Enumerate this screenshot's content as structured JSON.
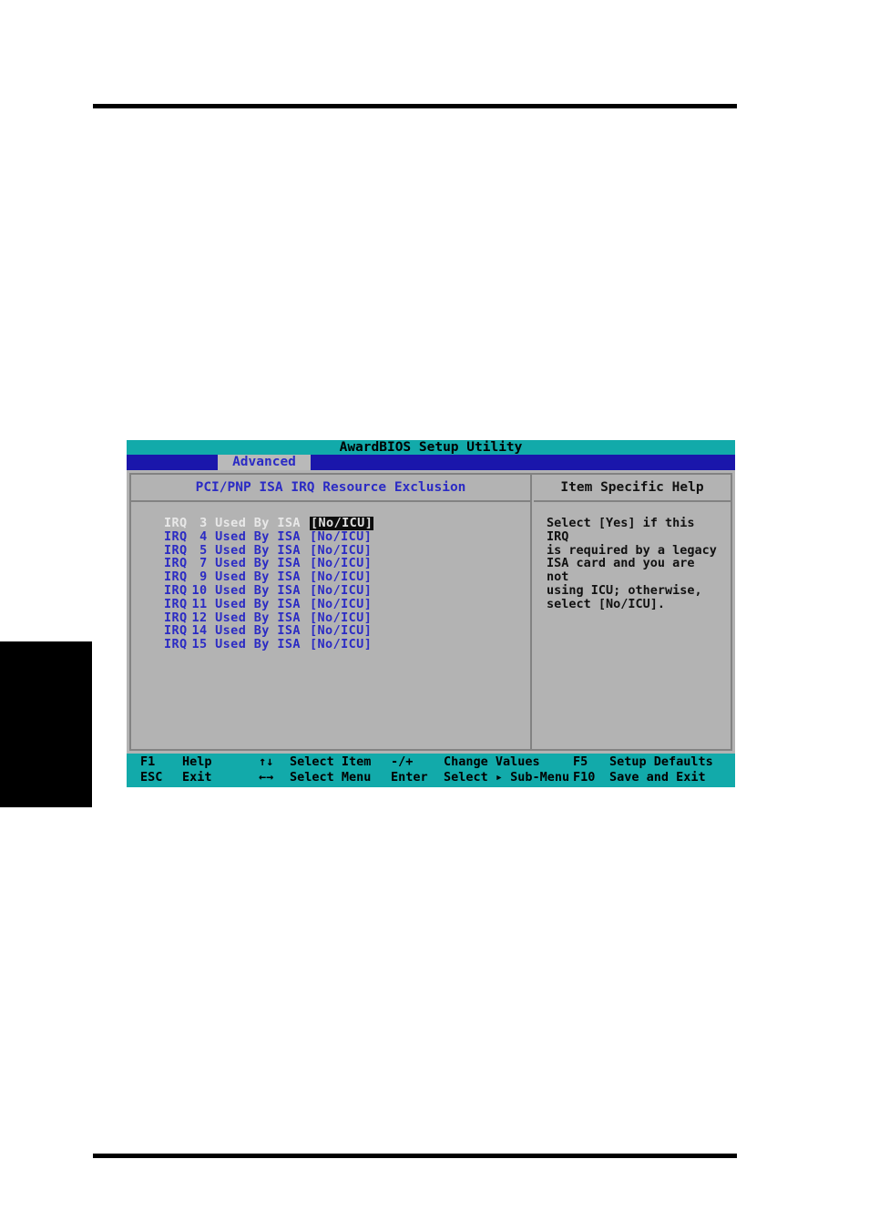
{
  "window": {
    "title": "AwardBIOS Setup Utility",
    "active_tab": "Advanced"
  },
  "main_panel": {
    "header": "PCI/PNP ISA IRQ Resource Exclusion",
    "rows": [
      {
        "label": "IRQ",
        "num": "3",
        "suffix": "Used By ISA",
        "value": "[No/ICU]",
        "selected": true
      },
      {
        "label": "IRQ",
        "num": "4",
        "suffix": "Used By ISA",
        "value": "[No/ICU]",
        "selected": false
      },
      {
        "label": "IRQ",
        "num": "5",
        "suffix": "Used By ISA",
        "value": "[No/ICU]",
        "selected": false
      },
      {
        "label": "IRQ",
        "num": "7",
        "suffix": "Used By ISA",
        "value": "[No/ICU]",
        "selected": false
      },
      {
        "label": "IRQ",
        "num": "9",
        "suffix": "Used By ISA",
        "value": "[No/ICU]",
        "selected": false
      },
      {
        "label": "IRQ",
        "num": "10",
        "suffix": "Used By ISA",
        "value": "[No/ICU]",
        "selected": false
      },
      {
        "label": "IRQ",
        "num": "11",
        "suffix": "Used By ISA",
        "value": "[No/ICU]",
        "selected": false
      },
      {
        "label": "IRQ",
        "num": "12",
        "suffix": "Used By ISA",
        "value": "[No/ICU]",
        "selected": false
      },
      {
        "label": "IRQ",
        "num": "14",
        "suffix": "Used By ISA",
        "value": "[No/ICU]",
        "selected": false
      },
      {
        "label": "IRQ",
        "num": "15",
        "suffix": "Used By ISA",
        "value": "[No/ICU]",
        "selected": false
      }
    ]
  },
  "help_panel": {
    "header": "Item Specific Help",
    "text": "Select [Yes] if this IRQ\nis required by a legacy\nISA card and you are not\nusing ICU; otherwise,\nselect [No/ICU]."
  },
  "footer": {
    "row1": {
      "key1": "F1",
      "action1": "Help",
      "key2": "↑↓",
      "action2": "Select Item",
      "key3": "-/+",
      "action3": "Change Values",
      "key4": "F5",
      "action4": "Setup Defaults"
    },
    "row2": {
      "key1": "ESC",
      "action1": "Exit",
      "key2": "←→",
      "action2": "Select Menu",
      "key3": "Enter",
      "action3": "Select ▸ Sub-Menu",
      "key4": "F10",
      "action4": "Save and Exit"
    }
  },
  "colors": {
    "titlebar": "#12aaaa",
    "tabstrip": "#1a16ab",
    "panel": "#b3b3b3",
    "accent_text": "#2b2bc4",
    "highlight_bg": "#0d0d0d"
  }
}
